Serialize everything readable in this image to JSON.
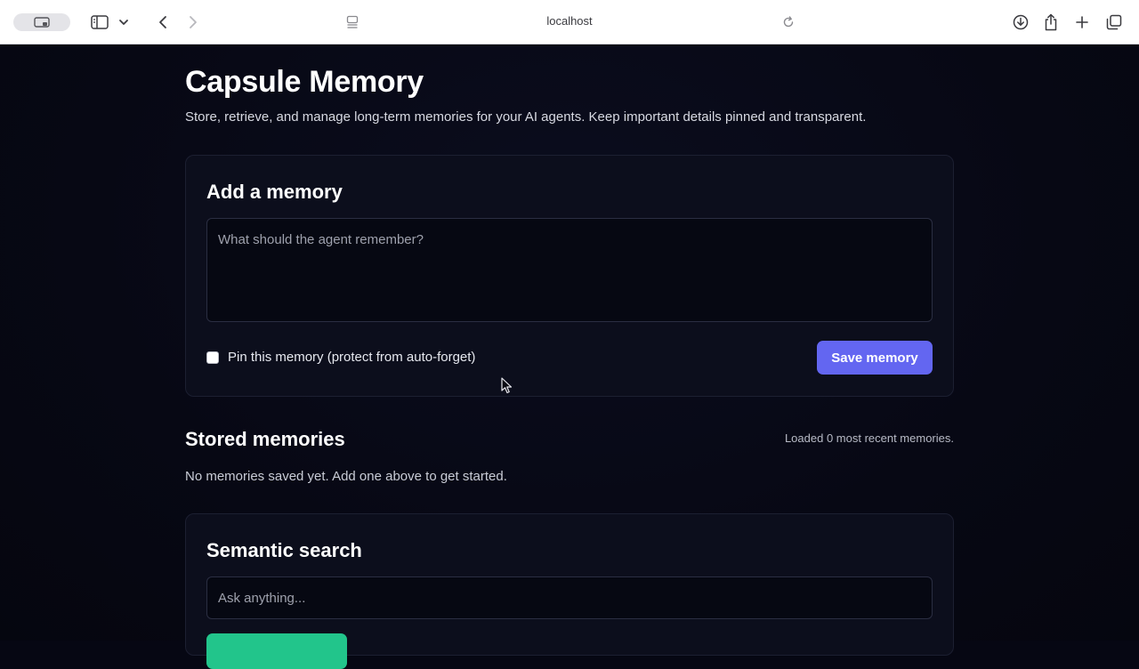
{
  "browser": {
    "url": "localhost",
    "icons": {
      "tab_overview": "tab-overview-icon",
      "sidebar": "sidebar-icon",
      "chevron": "chevron-down-icon",
      "back": "back-arrow-icon",
      "forward": "forward-arrow-icon",
      "reader": "reader-icon",
      "reload": "reload-icon",
      "download": "download-icon",
      "share": "share-icon",
      "new_tab": "plus-icon",
      "tabs": "tabs-icon"
    }
  },
  "header": {
    "title": "Capsule Memory",
    "subtitle": "Store, retrieve, and manage long-term memories for your AI agents. Keep important details pinned and transparent."
  },
  "add_memory": {
    "title": "Add a memory",
    "placeholder": "What should the agent remember?",
    "value": "",
    "pin_label": "Pin this memory (protect from auto-forget)",
    "pin_checked": false,
    "save_label": "Save memory"
  },
  "stored": {
    "title": "Stored memories",
    "loaded_text": "Loaded 0 most recent memories.",
    "empty_text": "No memories saved yet. Add one above to get started."
  },
  "search": {
    "title": "Semantic search",
    "placeholder": "Ask anything...",
    "value": ""
  },
  "colors": {
    "accent": "#6366f1",
    "search_button": "#22c58b",
    "background": "#060713",
    "card": "#0c0e1c"
  }
}
